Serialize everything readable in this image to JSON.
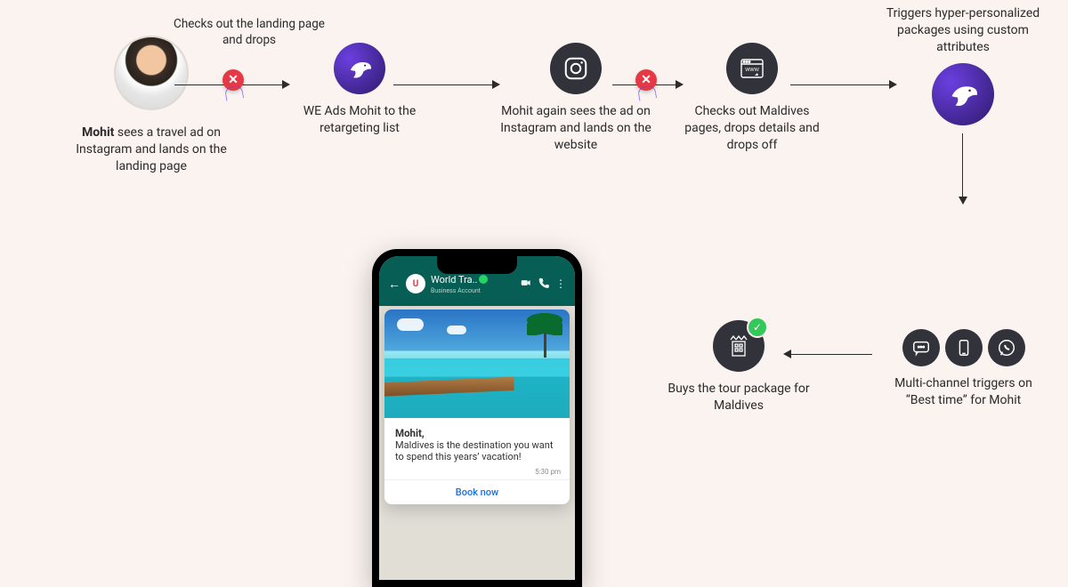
{
  "user_name": "Mohit",
  "steps": {
    "s1_continuation": " sees a travel ad on Instagram and lands on the landing page",
    "s1_top_note": "Checks out the landing page and drops",
    "s2": "WE Ads Mohit to the retargeting list",
    "s3": "Mohit again sees the ad on Instagram and lands on the website",
    "s4": "Checks out Maldives pages, drops details and drops off",
    "s5": "Triggers hyper-personalized packages using custom attributes",
    "s6": "Multi-channel triggers on “Best time” for Mohit",
    "s7": "Buys the tour package for Maldives"
  },
  "whatsapp": {
    "contact_name": "World Tra..",
    "contact_sub": "Business Account",
    "avatar_letter": "U",
    "greeting": "Mohit,",
    "message": "Maldives is the destination you want to spend this years’ vacation!",
    "time": "5:30 pm",
    "cta": "Book now"
  },
  "colors": {
    "bg": "#faf3ef",
    "dark": "#32323a",
    "red": "#e63946",
    "green": "#34c759",
    "purple_a": "#6b3fe0",
    "purple_b": "#2e1a6a",
    "wa_header": "#075e54",
    "link": "#1a6fe0"
  }
}
